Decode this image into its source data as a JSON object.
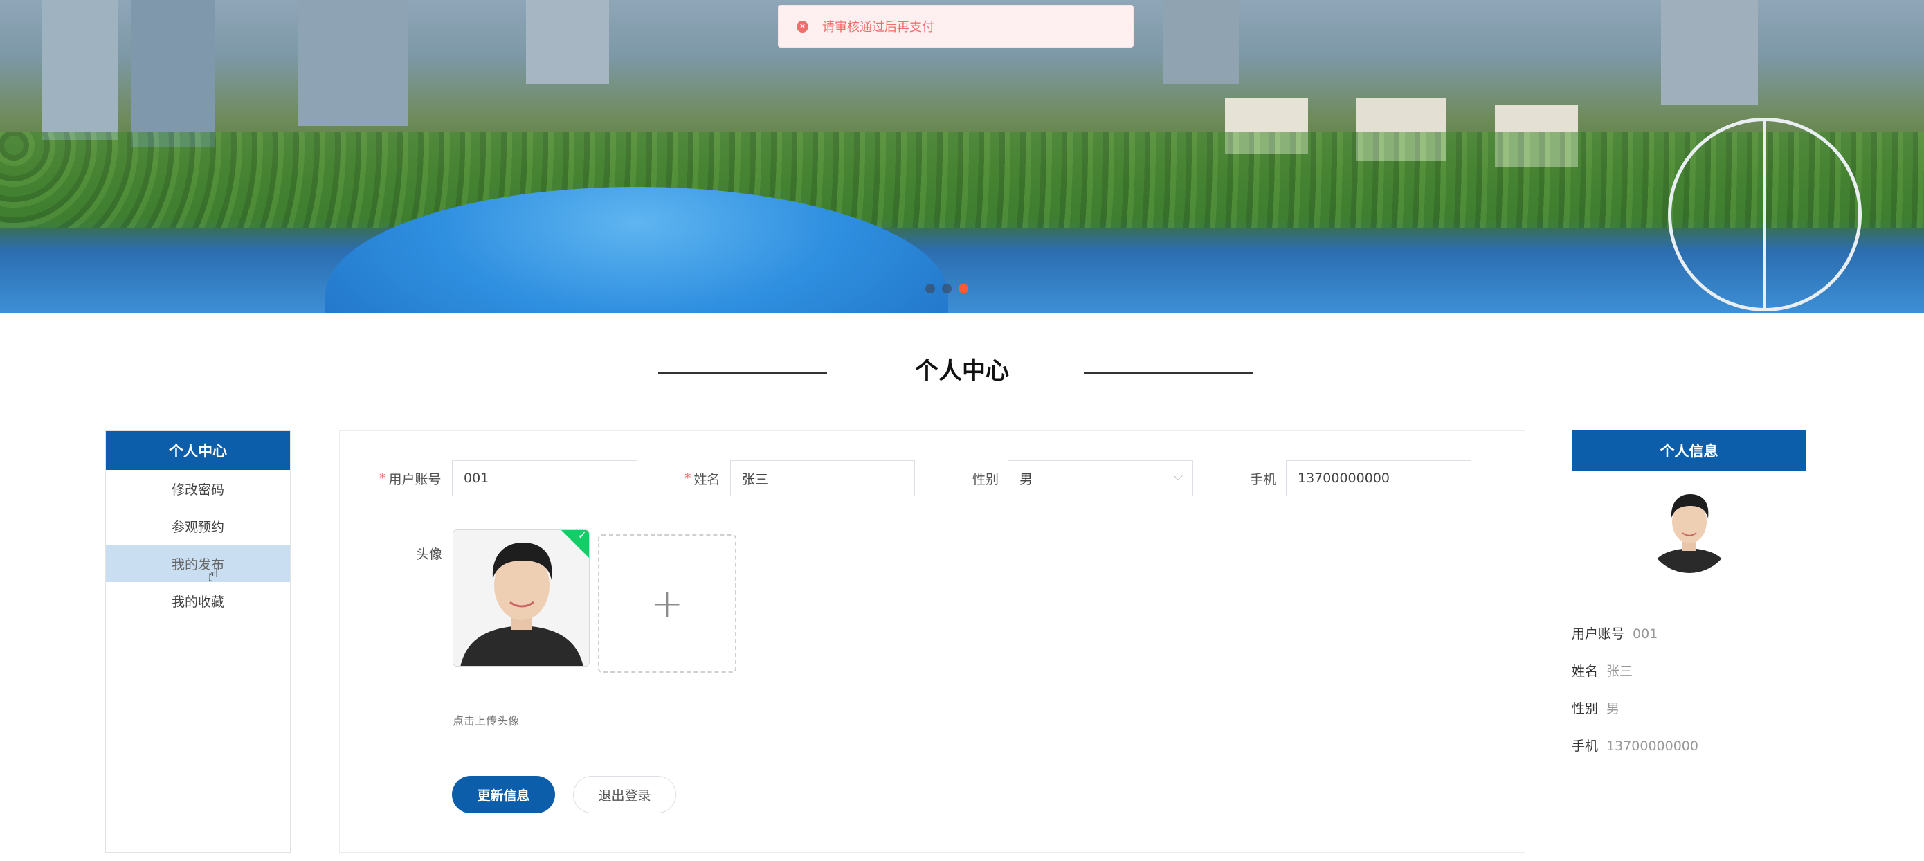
{
  "toast": {
    "message": "请审核通过后再支付",
    "icon": "error-circle-icon"
  },
  "carousel": {
    "slides": 3,
    "active": 3
  },
  "section": {
    "title": "个人中心"
  },
  "left_menu": {
    "header": "个人中心",
    "items": [
      {
        "label": "修改密码"
      },
      {
        "label": "参观预约"
      },
      {
        "label": "我的发布"
      },
      {
        "label": "我的收藏"
      }
    ]
  },
  "form": {
    "account_label": "用户账号",
    "account_value": "001",
    "name_label": "姓名",
    "name_value": "张三",
    "gender_label": "性别",
    "gender_value": "男",
    "phone_label": "手机",
    "phone_value": "13700000000",
    "avatar_label": "头像",
    "upload_hint": "点击上传头像",
    "update_button": "更新信息",
    "logout_button": "退出登录"
  },
  "profile": {
    "header": "个人信息",
    "fields": [
      {
        "label": "用户账号",
        "value": "001"
      },
      {
        "label": "姓名",
        "value": "张三"
      },
      {
        "label": "性别",
        "value": "男"
      },
      {
        "label": "手机",
        "value": "13700000000"
      }
    ]
  },
  "colors": {
    "primary": "#0c5eab",
    "error": "#f56c6c",
    "accent_dot": "#ff5a35",
    "success": "#13ce66"
  }
}
